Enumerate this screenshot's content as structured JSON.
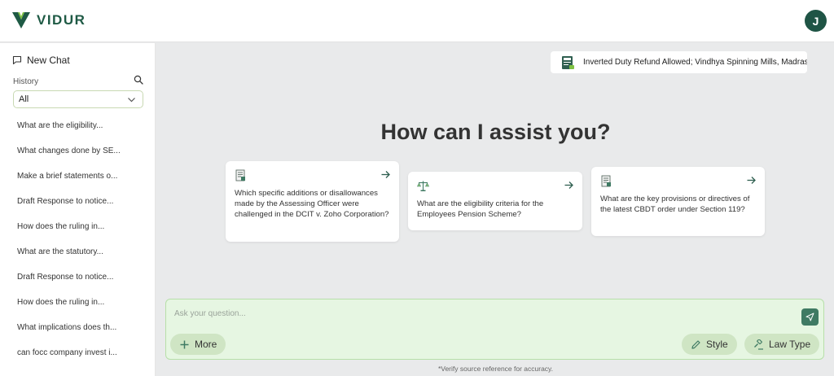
{
  "header": {
    "brand": "VIDUR",
    "avatar_initial": "J",
    "brand_color": "#1f5a45",
    "accent_color": "#7ec242"
  },
  "sidebar": {
    "new_chat_label": "New Chat",
    "new_chat_icon": "chat-plus-icon",
    "history_label": "History",
    "search_icon": "search-icon",
    "filter_value": "All",
    "history": [
      "What are the eligibility...",
      "What changes done by SE...",
      "Make a brief statements o...",
      "Draft Response to notice...",
      "How does the ruling in...",
      "What are the statutory...",
      "Draft Response to notice...",
      "How does the ruling in...",
      "What implications does th...",
      "can focc company invest i..."
    ]
  },
  "banner": {
    "icon": "gst-document-icon",
    "text": "Inverted Duty Refund Allowed; Vindhya Spinning Mills, Madras"
  },
  "main": {
    "headline": "How can I assist you?",
    "cards": [
      {
        "icon": "document-icon",
        "text": "Which specific additions or disallowances made by the Assessing Officer were challenged in the DCIT v. Zoho Corporation?"
      },
      {
        "icon": "scales-icon",
        "text": "What are the eligibility criteria for the Employees Pension Scheme?"
      },
      {
        "icon": "document-icon",
        "text": "What are the key provisions or directives of the latest CBDT order under Section 119?"
      }
    ]
  },
  "composer": {
    "placeholder": "Ask your question...",
    "more_label": "More",
    "style_label": "Style",
    "law_type_label": "Law Type",
    "disclaimer": "*Verify source reference for accuracy."
  }
}
